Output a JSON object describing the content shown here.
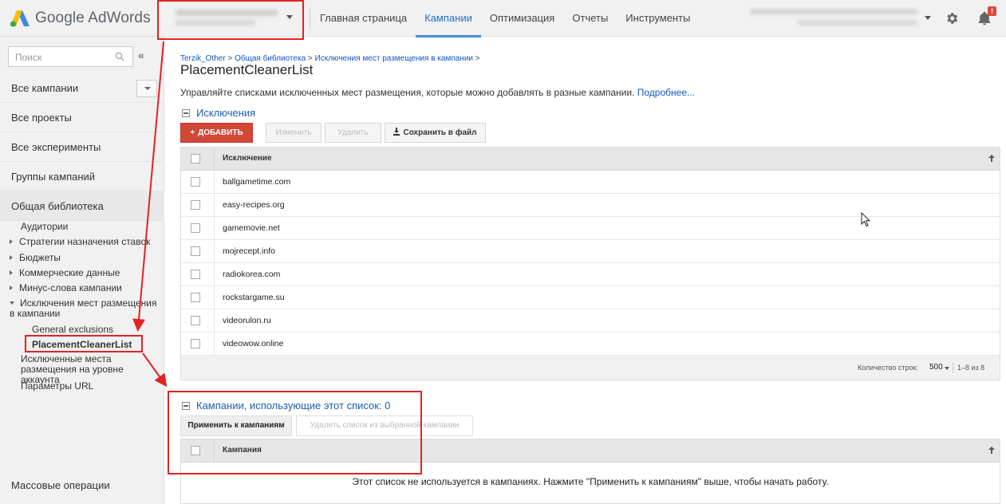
{
  "app": {
    "name": "Google AdWords"
  },
  "nav": {
    "items": [
      "Главная страница",
      "Кампании",
      "Оптимизация",
      "Отчеты",
      "Инструменты"
    ],
    "active": "Кампании"
  },
  "notifications": {
    "badge": "!"
  },
  "sidebar": {
    "search_placeholder": "Поиск",
    "collapse_label": "«",
    "items": [
      "Все кампании",
      "Все проекты",
      "Все эксперименты",
      "Группы кампаний",
      "Общая библиотека"
    ],
    "tree": [
      "Аудитории",
      "Стратегии назначения ставок",
      "Бюджеты",
      "Коммерческие данные",
      "Минус-слова кампании",
      "Исключения мест размещения в кампании",
      "General exclusions",
      "PlacementCleanerList",
      "Исключенные места размещения на уровне аккаунта",
      "Параметры URL"
    ],
    "mass_ops": "Массовые операции"
  },
  "breadcrumb": {
    "items": [
      "Terzik_Other",
      "Общая библиотека",
      "Исключения мест размещения в кампании"
    ],
    "sep": ">"
  },
  "page": {
    "title": "PlacementCleanerList",
    "description": "Управляйте списками исключенных мест размещения, которые можно добавлять в разные кампании.",
    "more_link": "Подробнее..."
  },
  "exclusions": {
    "header": "Исключения",
    "buttons": {
      "add": "ДОБАВИТЬ",
      "edit": "Изменить",
      "delete": "Удалить",
      "save": "Сохранить в файл"
    },
    "column": "Исключение",
    "rows": [
      "ballgametime.com",
      "easy-recipes.org",
      "gamemovie.net",
      "mojrecept.info",
      "radiokorea.com",
      "rockstargame.su",
      "videorulon.ru",
      "videowow.online"
    ],
    "rows_label": "Количество строк:",
    "rows_value": "500",
    "pagination": "1–8 из 8"
  },
  "campaigns": {
    "header": "Кампании, использующие этот список: 0",
    "tabs": {
      "apply": "Применить к кампаниям",
      "remove": "Удалить список из выбранной кампании"
    },
    "column": "Кампания",
    "empty": "Этот список не используется в кампаниях. Нажмите \"Применить к кампаниям\" выше, чтобы начать работу."
  },
  "colors": {
    "accent": "#1a73c8",
    "add_button": "#d14836",
    "annotation": "#e32222"
  }
}
